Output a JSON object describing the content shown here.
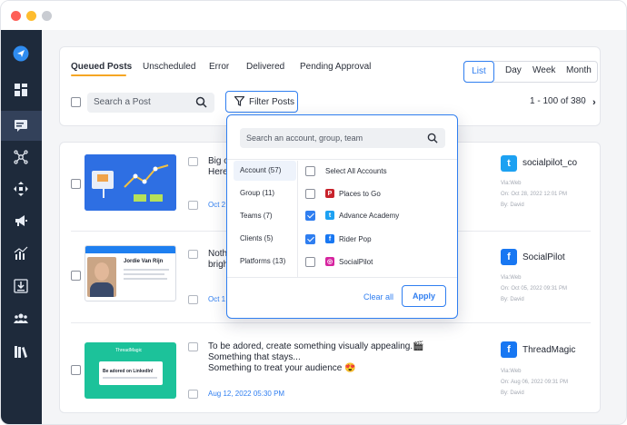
{
  "tabs": [
    {
      "label": "Queued Posts",
      "active": true
    },
    {
      "label": "Unscheduled"
    },
    {
      "label": "Error"
    },
    {
      "label": "Delivered"
    },
    {
      "label": "Pending Approval"
    }
  ],
  "view_toggle": [
    "List",
    "Day",
    "Week",
    "Month"
  ],
  "search": {
    "placeholder": "Search a Post"
  },
  "filter_button": "Filter Posts",
  "pagination": "1 - 100 of 380",
  "filter_dropdown": {
    "search_placeholder": "Search an account, group, team",
    "categories": [
      "Account (57)",
      "Group (11)",
      "Teams (7)",
      "Clients (5)",
      "Platforms (13)"
    ],
    "items": [
      {
        "label": "Select All Accounts",
        "checked": false,
        "icon": ""
      },
      {
        "label": "Places to Go",
        "checked": false,
        "icon": "pinterest-icon",
        "color": "#c8232c",
        "glyph": "P"
      },
      {
        "label": "Advance Academy",
        "checked": true,
        "icon": "twitter-icon",
        "color": "#1da1f2",
        "glyph": "t"
      },
      {
        "label": "Rider Pop",
        "checked": true,
        "icon": "facebook-icon",
        "color": "#1877f2",
        "glyph": "f"
      },
      {
        "label": "SocialPilot",
        "checked": false,
        "icon": "instagram-icon",
        "color": "#d6249f",
        "glyph": "◎"
      }
    ],
    "clear_label": "Clear all",
    "apply_label": "Apply"
  },
  "posts": [
    {
      "text_lines": [
        "Big o",
        "Here"
      ],
      "date": "Oct 2",
      "account": "socialpilot_co",
      "network": "twitter",
      "meta": [
        "Via:Web",
        "On: Oct 28, 2022 12:01 PM",
        "By: David"
      ]
    },
    {
      "text_lines": [
        "Noth",
        "brigh"
      ],
      "date": "Oct 1",
      "account": "SocialPilot",
      "network": "facebook",
      "meta": [
        "Via:Web",
        "On: Oct 05, 2022 09:31 PM",
        "By: David"
      ],
      "thumb_name": "Jordie Van Rijn"
    },
    {
      "text_lines": [
        "To be adored, create something visually appealing.🎬",
        "Something that stays...",
        "Something to treat your audience 😍"
      ],
      "date": "Aug 12, 2022 05:30 PM",
      "account": "ThreadMagic",
      "network": "facebook",
      "meta": [
        "Via:Web",
        "On: Aug 06, 2022 09:31 PM",
        "By: David"
      ],
      "thumb_brand": "ThreadMagic",
      "thumb_caption": "Be adored on LinkedIn!"
    }
  ],
  "colors": {
    "accent": "#2f7ef0",
    "sidebar": "#1e2a3b",
    "tab_underline": "#f5a623"
  }
}
